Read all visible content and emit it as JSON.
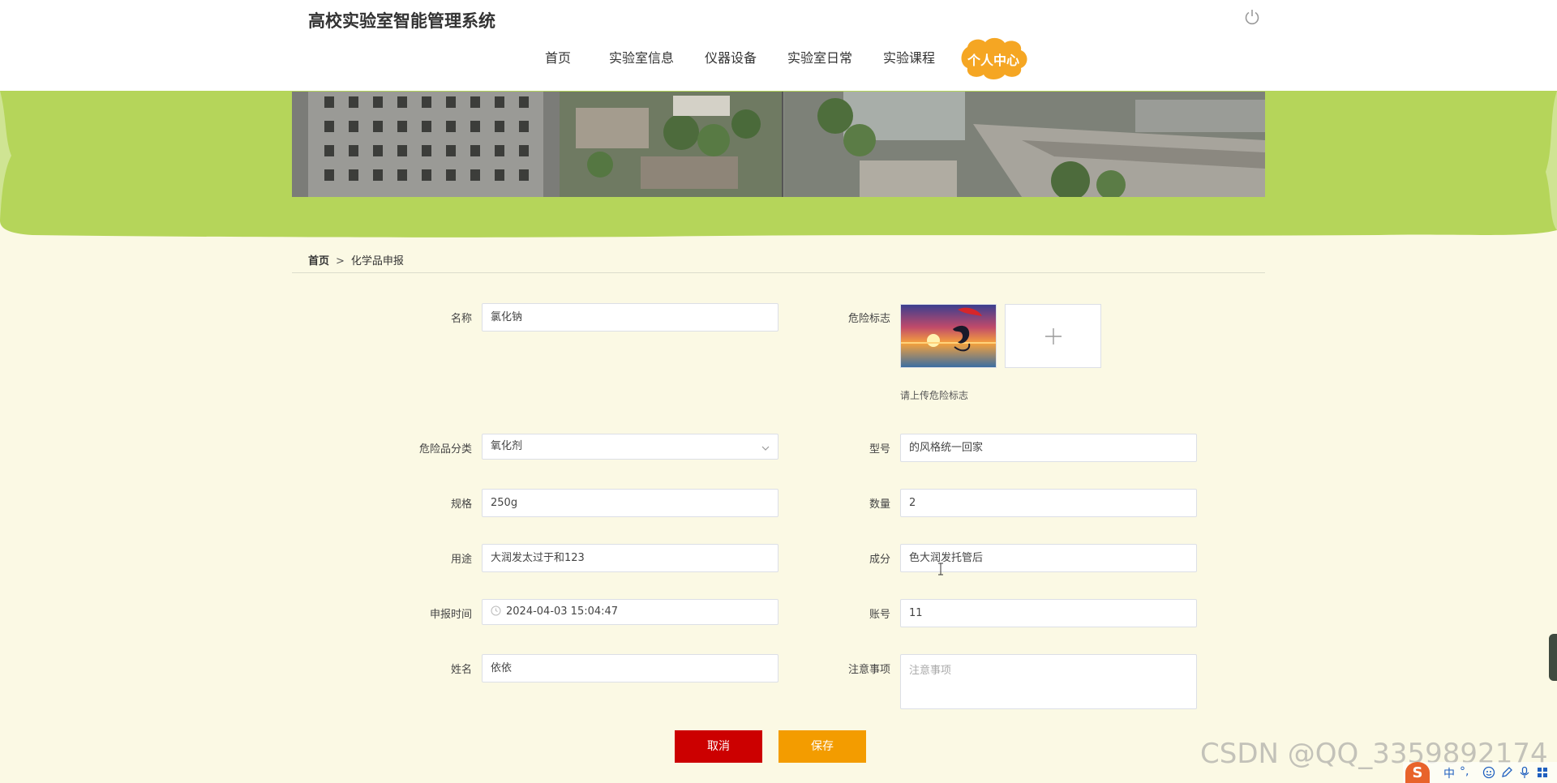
{
  "header": {
    "site_title": "高校实验室智能管理系统",
    "nav": [
      {
        "label": "首页"
      },
      {
        "label": "实验室信息"
      },
      {
        "label": "仪器设备"
      },
      {
        "label": "实验室日常"
      },
      {
        "label": "实验课程"
      }
    ],
    "nav_active": "个人中心",
    "accent_color": "#f5a623"
  },
  "banner": {
    "band_color": "#b5d55a"
  },
  "breadcrumb": {
    "home": "首页",
    "separator": ">",
    "current": "化学品申报"
  },
  "form": {
    "name": {
      "label": "名称",
      "value": "氯化钠"
    },
    "hazard_symbol": {
      "label": "危险标志",
      "hint": "请上传危险标志"
    },
    "category": {
      "label": "危险品分类",
      "value": "氧化剂"
    },
    "model": {
      "label": "型号",
      "value": "的风格统一回家"
    },
    "spec": {
      "label": "规格",
      "value": "250g"
    },
    "quantity": {
      "label": "数量",
      "value": "2"
    },
    "usage": {
      "label": "用途",
      "value": "大润发太过于和123"
    },
    "composition": {
      "label": "成分",
      "value": "色大润发托管后"
    },
    "report_time": {
      "label": "申报时间",
      "value": "2024-04-03 15:04:47"
    },
    "account": {
      "label": "账号",
      "value": "11"
    },
    "person_name": {
      "label": "姓名",
      "value": "依依"
    },
    "notes": {
      "label": "注意事项",
      "placeholder": "注意事项"
    }
  },
  "buttons": {
    "cancel": "取消",
    "save": "保存"
  },
  "watermark": "CSDN @QQ_3359892174",
  "ime": {
    "logo": "S",
    "lang": "中",
    "punct": "°,"
  }
}
